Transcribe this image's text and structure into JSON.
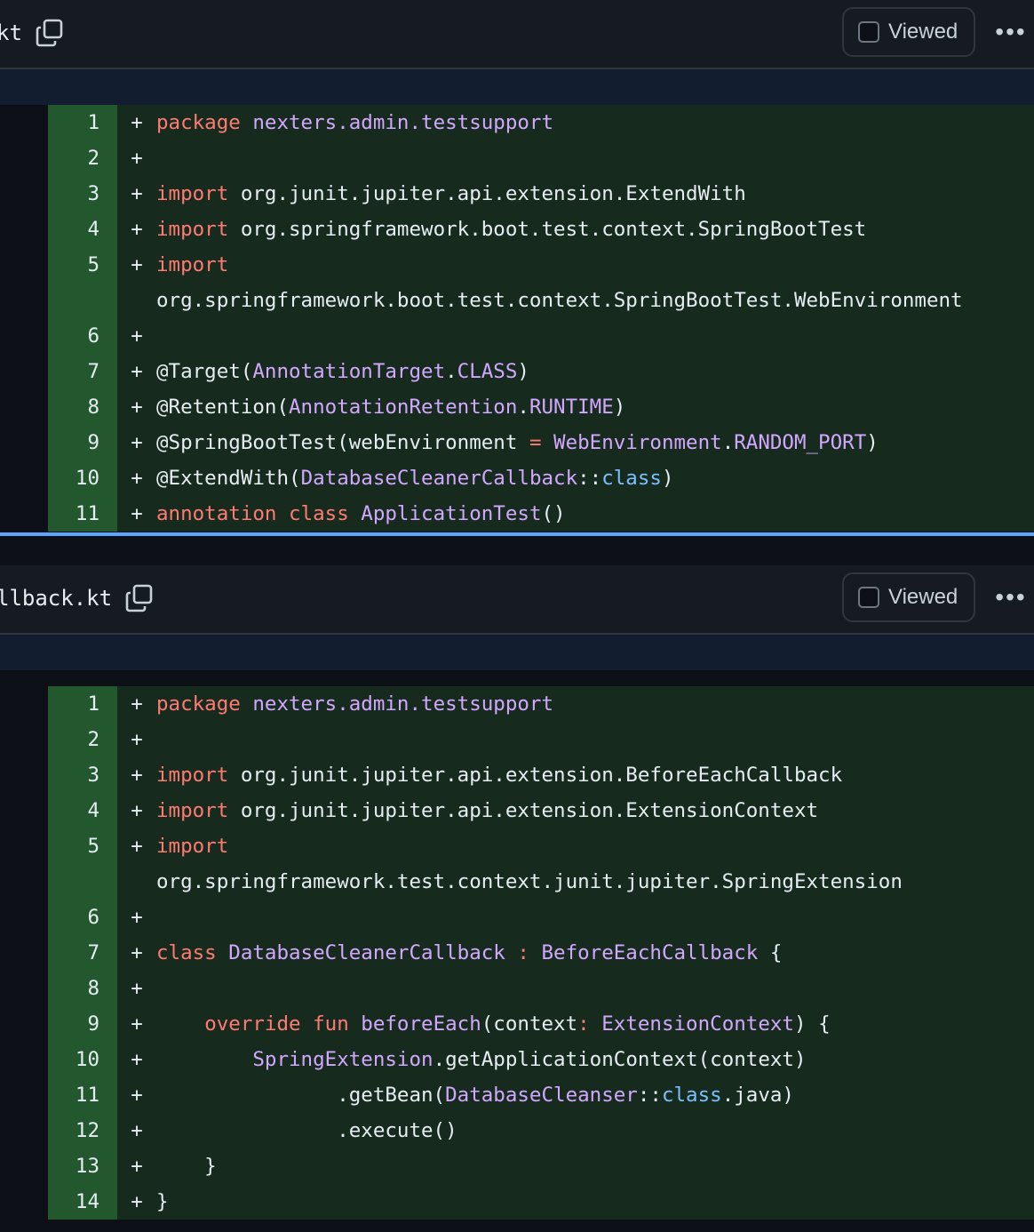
{
  "files": [
    {
      "name": "kt",
      "viewed_label": "Viewed",
      "more_label": "•••",
      "lines": [
        {
          "num": "1",
          "marker": "+",
          "tokens": [
            {
              "t": "kw",
              "s": "package"
            },
            {
              "t": "tx",
              "s": " "
            },
            {
              "t": "ty",
              "s": "nexters.admin.testsupport"
            }
          ]
        },
        {
          "num": "2",
          "marker": "+",
          "tokens": []
        },
        {
          "num": "3",
          "marker": "+",
          "tokens": [
            {
              "t": "kw",
              "s": "import"
            },
            {
              "t": "tx",
              "s": " org.junit.jupiter.api.extension.ExtendWith"
            }
          ]
        },
        {
          "num": "4",
          "marker": "+",
          "tokens": [
            {
              "t": "kw",
              "s": "import"
            },
            {
              "t": "tx",
              "s": " org.springframework.boot.test.context.SpringBootTest"
            }
          ]
        },
        {
          "num": "5",
          "marker": "+",
          "tokens": [
            {
              "t": "kw",
              "s": "import"
            }
          ]
        },
        {
          "num": "",
          "marker": "",
          "tokens": [
            {
              "t": "tx",
              "s": "org.springframework.boot.test.context.SpringBootTest.WebEnvironment"
            }
          ]
        },
        {
          "num": "6",
          "marker": "+",
          "tokens": []
        },
        {
          "num": "7",
          "marker": "+",
          "tokens": [
            {
              "t": "tx",
              "s": "@Target("
            },
            {
              "t": "ty",
              "s": "AnnotationTarget"
            },
            {
              "t": "tx",
              "s": "."
            },
            {
              "t": "ty",
              "s": "CLASS"
            },
            {
              "t": "tx",
              "s": ")"
            }
          ]
        },
        {
          "num": "8",
          "marker": "+",
          "tokens": [
            {
              "t": "tx",
              "s": "@Retention("
            },
            {
              "t": "ty",
              "s": "AnnotationRetention"
            },
            {
              "t": "tx",
              "s": "."
            },
            {
              "t": "ty",
              "s": "RUNTIME"
            },
            {
              "t": "tx",
              "s": ")"
            }
          ]
        },
        {
          "num": "9",
          "marker": "+",
          "tokens": [
            {
              "t": "tx",
              "s": "@SpringBootTest(webEnvironment "
            },
            {
              "t": "kw",
              "s": "="
            },
            {
              "t": "tx",
              "s": " "
            },
            {
              "t": "ty",
              "s": "WebEnvironment"
            },
            {
              "t": "tx",
              "s": "."
            },
            {
              "t": "ty",
              "s": "RANDOM_PORT"
            },
            {
              "t": "tx",
              "s": ")"
            }
          ]
        },
        {
          "num": "10",
          "marker": "+",
          "tokens": [
            {
              "t": "tx",
              "s": "@ExtendWith("
            },
            {
              "t": "ty",
              "s": "DatabaseCleanerCallback"
            },
            {
              "t": "tx",
              "s": "::"
            },
            {
              "t": "cn",
              "s": "class"
            },
            {
              "t": "tx",
              "s": ")"
            }
          ]
        },
        {
          "num": "11",
          "marker": "+",
          "tokens": [
            {
              "t": "kw",
              "s": "annotation class"
            },
            {
              "t": "tx",
              "s": " "
            },
            {
              "t": "en",
              "s": "ApplicationTest"
            },
            {
              "t": "tx",
              "s": "()"
            }
          ]
        }
      ]
    },
    {
      "name": "llback.kt",
      "viewed_label": "Viewed",
      "more_label": "•••",
      "lines": [
        {
          "num": "1",
          "marker": "+",
          "tokens": [
            {
              "t": "kw",
              "s": "package"
            },
            {
              "t": "tx",
              "s": " "
            },
            {
              "t": "ty",
              "s": "nexters.admin.testsupport"
            }
          ]
        },
        {
          "num": "2",
          "marker": "+",
          "tokens": []
        },
        {
          "num": "3",
          "marker": "+",
          "tokens": [
            {
              "t": "kw",
              "s": "import"
            },
            {
              "t": "tx",
              "s": " org.junit.jupiter.api.extension.BeforeEachCallback"
            }
          ]
        },
        {
          "num": "4",
          "marker": "+",
          "tokens": [
            {
              "t": "kw",
              "s": "import"
            },
            {
              "t": "tx",
              "s": " org.junit.jupiter.api.extension.ExtensionContext"
            }
          ]
        },
        {
          "num": "5",
          "marker": "+",
          "tokens": [
            {
              "t": "kw",
              "s": "import"
            }
          ]
        },
        {
          "num": "",
          "marker": "",
          "tokens": [
            {
              "t": "tx",
              "s": "org.springframework.test.context.junit.jupiter.SpringExtension"
            }
          ]
        },
        {
          "num": "6",
          "marker": "+",
          "tokens": []
        },
        {
          "num": "7",
          "marker": "+",
          "tokens": [
            {
              "t": "kw",
              "s": "class"
            },
            {
              "t": "tx",
              "s": " "
            },
            {
              "t": "en",
              "s": "DatabaseCleanerCallback"
            },
            {
              "t": "tx",
              "s": " "
            },
            {
              "t": "kw",
              "s": ":"
            },
            {
              "t": "tx",
              "s": " "
            },
            {
              "t": "ty",
              "s": "BeforeEachCallback"
            },
            {
              "t": "tx",
              "s": " {"
            }
          ]
        },
        {
          "num": "8",
          "marker": "+",
          "tokens": []
        },
        {
          "num": "9",
          "marker": "+",
          "tokens": [
            {
              "t": "tx",
              "s": "    "
            },
            {
              "t": "kw",
              "s": "override fun"
            },
            {
              "t": "tx",
              "s": " "
            },
            {
              "t": "en",
              "s": "beforeEach"
            },
            {
              "t": "tx",
              "s": "(context"
            },
            {
              "t": "kw",
              "s": ":"
            },
            {
              "t": "tx",
              "s": " "
            },
            {
              "t": "ty",
              "s": "ExtensionContext"
            },
            {
              "t": "tx",
              "s": ") {"
            }
          ]
        },
        {
          "num": "10",
          "marker": "+",
          "tokens": [
            {
              "t": "tx",
              "s": "        "
            },
            {
              "t": "ty",
              "s": "SpringExtension"
            },
            {
              "t": "tx",
              "s": ".getApplicationContext(context)"
            }
          ]
        },
        {
          "num": "11",
          "marker": "+",
          "tokens": [
            {
              "t": "tx",
              "s": "               .getBean("
            },
            {
              "t": "ty",
              "s": "DatabaseCleanser"
            },
            {
              "t": "tx",
              "s": "::"
            },
            {
              "t": "cn",
              "s": "class"
            },
            {
              "t": "tx",
              "s": ".java)"
            }
          ]
        },
        {
          "num": "12",
          "marker": "+",
          "tokens": [
            {
              "t": "tx",
              "s": "               .execute()"
            }
          ]
        },
        {
          "num": "13",
          "marker": "+",
          "tokens": [
            {
              "t": "tx",
              "s": "    }"
            }
          ]
        },
        {
          "num": "14",
          "marker": "+",
          "tokens": [
            {
              "t": "tx",
              "s": "}"
            }
          ]
        }
      ]
    }
  ]
}
